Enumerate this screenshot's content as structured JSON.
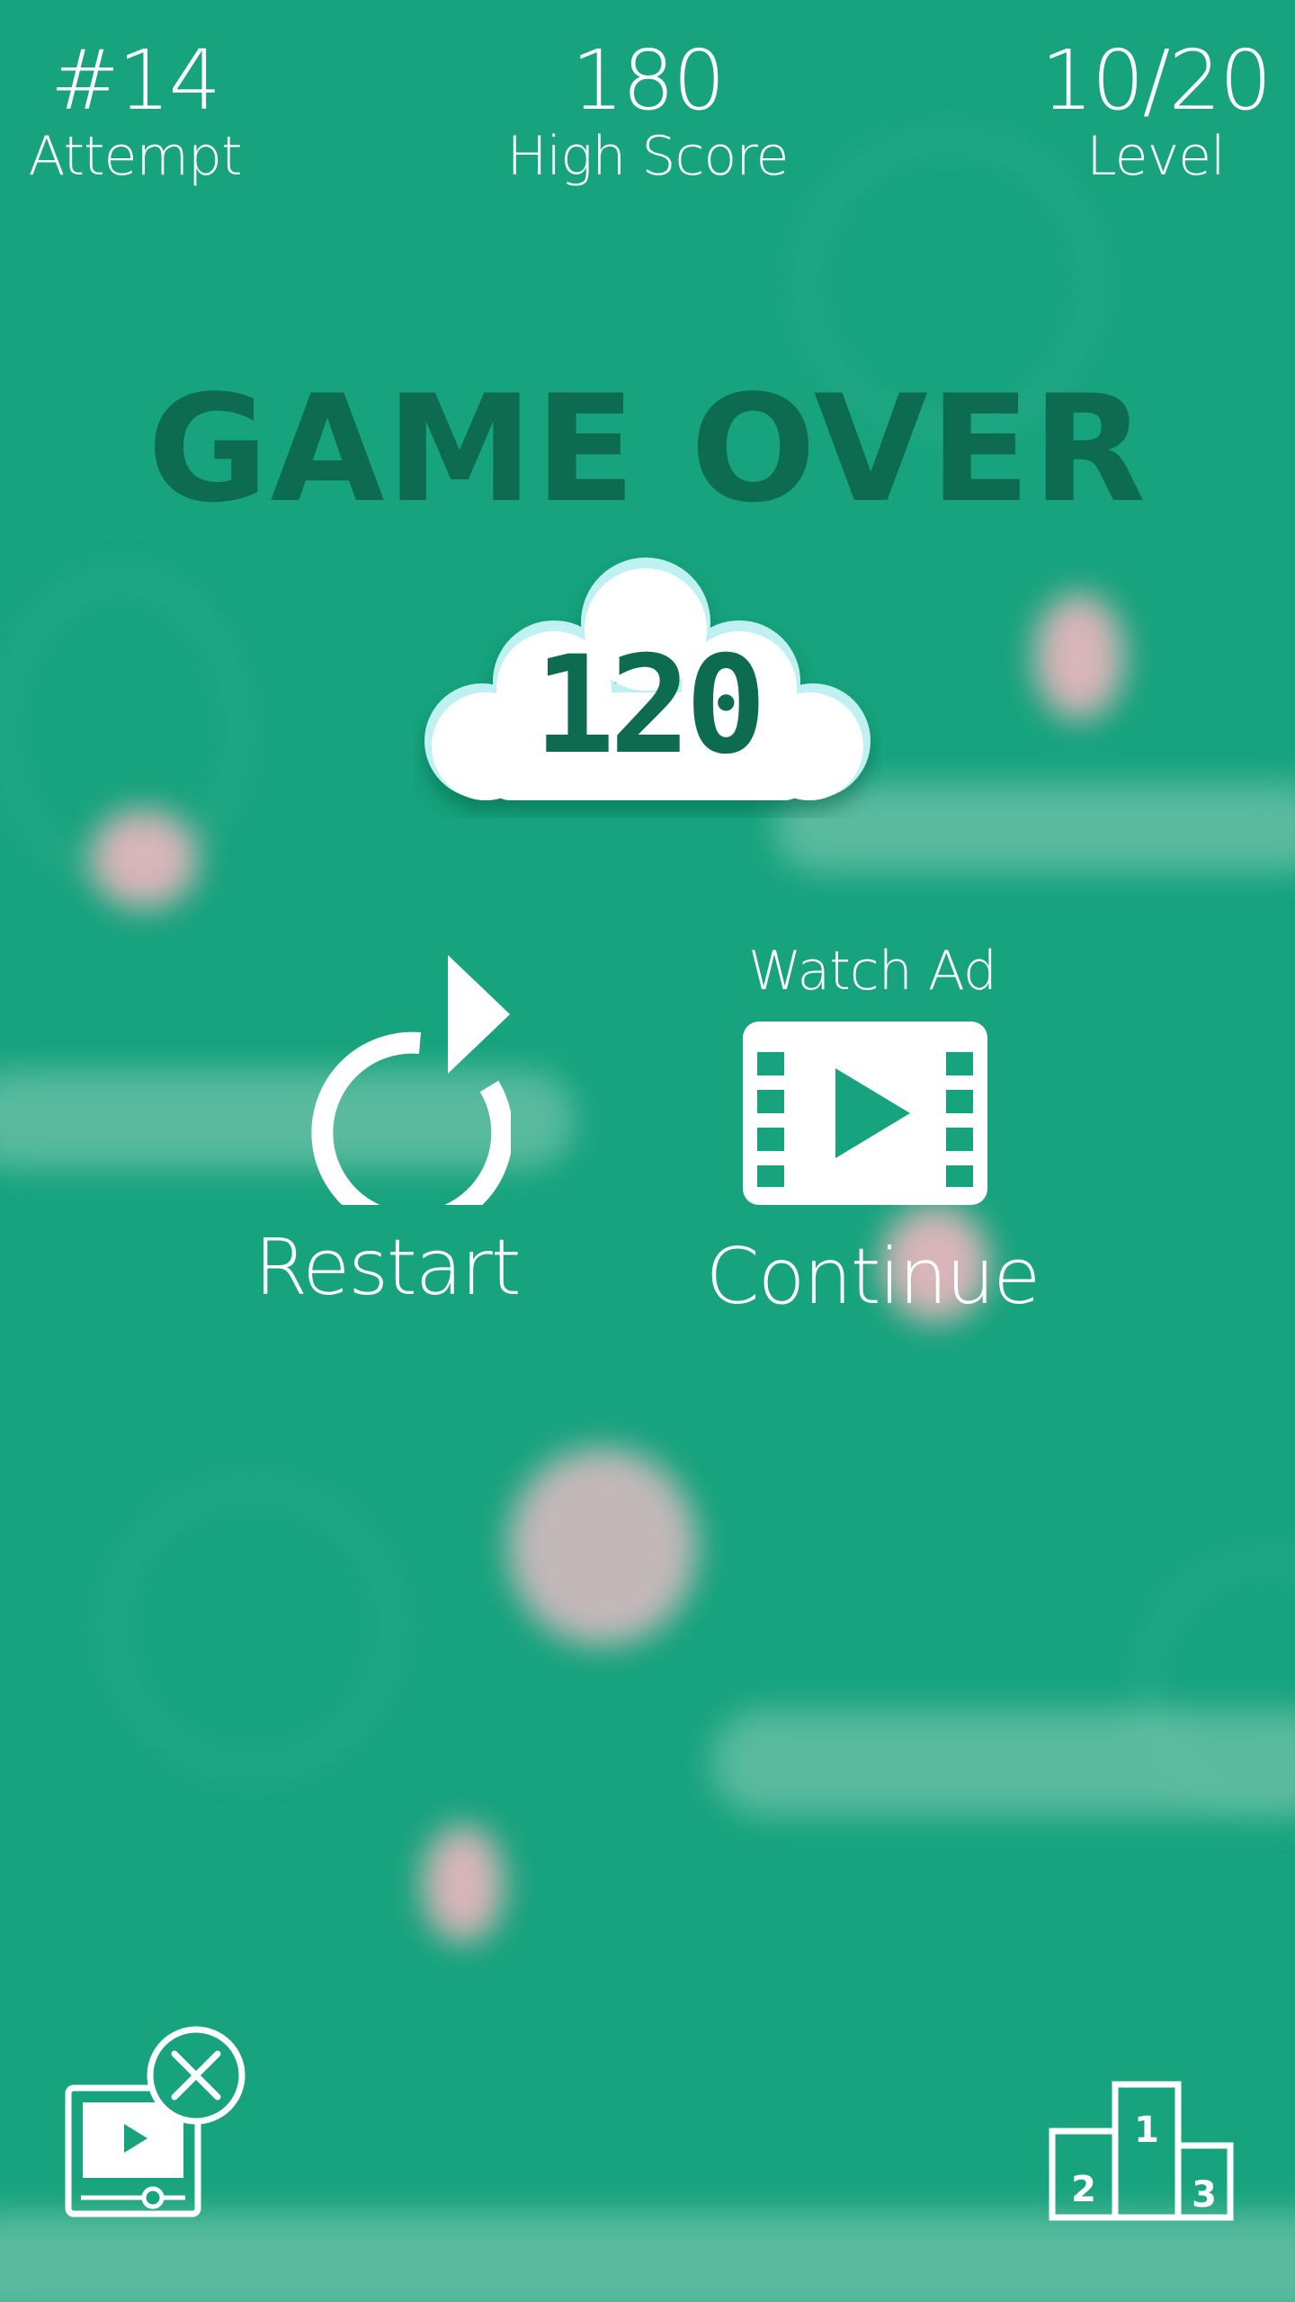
{
  "hud": {
    "attempt": {
      "value": "#14",
      "label": "Attempt"
    },
    "high_score": {
      "value": "180",
      "label": "High Score"
    },
    "level": {
      "value": "10/20",
      "label": "Level"
    }
  },
  "title": "GAME OVER",
  "score": "120",
  "actions": {
    "restart_label": "Restart",
    "watch_ad_label": "Watch Ad",
    "continue_label": "Continue"
  },
  "leaderboard": {
    "places": [
      "1",
      "2",
      "3"
    ]
  },
  "icons": {
    "restart": "restart-icon",
    "continue": "film-play-icon",
    "remove_ads": "remove-ads-icon",
    "leaderboard": "podium-icon"
  },
  "colors": {
    "background": "#16a37d",
    "title": "#0d6b4f",
    "text": "#ffffff",
    "cloud_rim": "#bff0f2"
  }
}
